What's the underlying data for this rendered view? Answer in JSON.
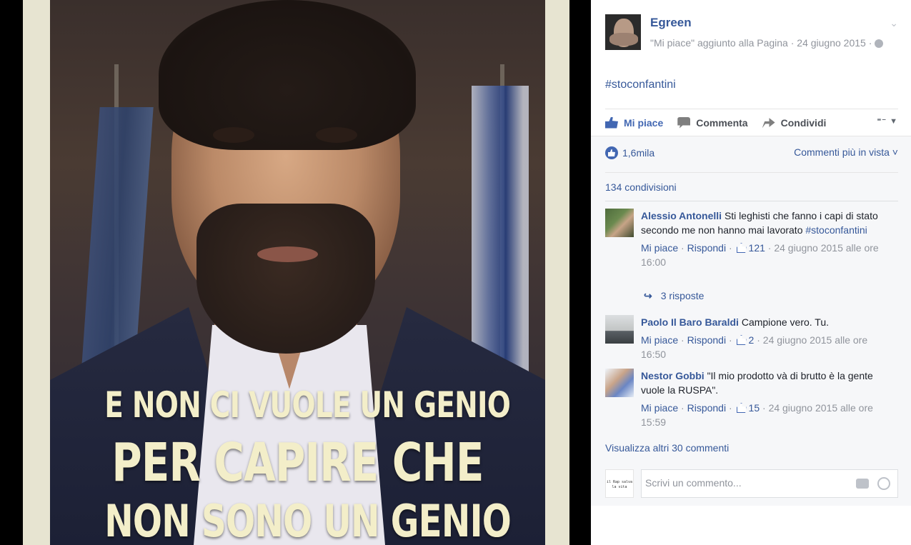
{
  "photo": {
    "quote_line1": "E NON CI VUOLE UN GENIO",
    "quote_line2": "PER CAPIRE CHE",
    "quote_line3": "NON SONO UN GENIO"
  },
  "post": {
    "author": "Egreen",
    "meta": "\"Mi piace\" aggiunto alla Pagina · 24 giugno 2015 ·",
    "privacy_icon": "globe-icon",
    "text": "#stoconfantini"
  },
  "actions": {
    "like": "Mi piace",
    "comment": "Commenta",
    "share": "Condividi"
  },
  "reactions": {
    "like_count": "1,6mila",
    "sort_label": "Commenti più in vista",
    "shares": "134 condivisioni"
  },
  "comments": [
    {
      "name": "Alessio Antonelli",
      "text": "Sti leghisti che fanno i capi di stato secondo me non hanno mai lavorato",
      "tag": "#stoconfantini",
      "like": "Mi piace",
      "reply": "Rispondi",
      "likes": "121",
      "time": "24 giugno 2015 alle ore 16:00",
      "replies": "3 risposte"
    },
    {
      "name": "Paolo Il Baro Baraldi",
      "text": "Campione vero. Tu.",
      "like": "Mi piace",
      "reply": "Rispondi",
      "likes": "2",
      "time": "24 giugno 2015 alle ore 16:50"
    },
    {
      "name": "Nestor Gobbi",
      "text": "\"Il mio prodotto và di brutto è la gente vuole la RUSPA\".",
      "like": "Mi piace",
      "reply": "Rispondi",
      "likes": "15",
      "time": "24 giugno 2015 alle ore 15:59"
    }
  ],
  "more_comments": "Visualizza altri 30 commenti",
  "composer": {
    "placeholder": "Scrivi un commento...",
    "avatar_text": "il Rap salva la vita"
  },
  "colors": {
    "link": "#365899",
    "accent": "#4267b2",
    "muted": "#90949c"
  }
}
